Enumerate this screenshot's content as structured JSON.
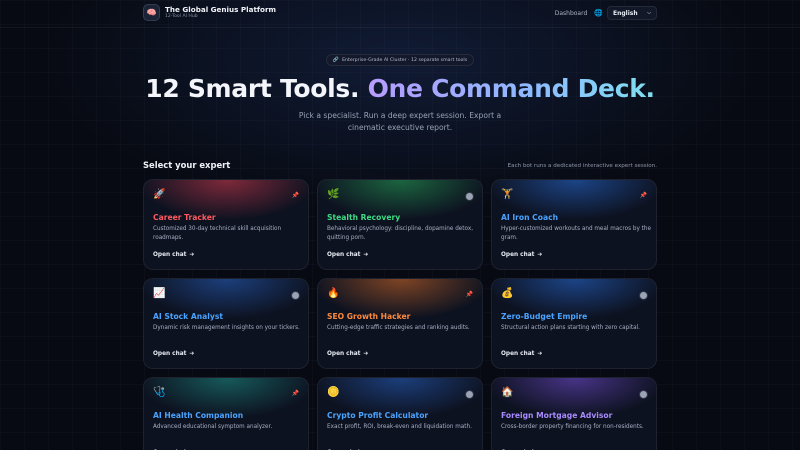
{
  "app": {
    "logo_icon": "🧠",
    "title": "The Global Genius Platform",
    "subtitle": "12-Tool AI Hub"
  },
  "nav": {
    "dashboard": "Dashboard",
    "globe_icon": "🌐",
    "language": "English",
    "chevron": "⌵"
  },
  "hero": {
    "badge_icon": "🔗",
    "badge": "Enterprise-Grade AI Cluster · 12 separate smart tools",
    "title_part1": "12 Smart Tools.",
    "title_part2": "One Command Deck.",
    "subtitle": "Pick a specialist. Run a deep expert session. Export a cinematic executive report."
  },
  "section": {
    "title": "Select your expert",
    "note": "Each bot runs a dedicated interactive expert session."
  },
  "cards": [
    {
      "icon": "🚀",
      "title": "Career Tracker",
      "desc": "Customized 30-day technical skill acquisition roadmaps.",
      "link": "Open chat",
      "arrow": "➔",
      "accent": "#ff5a5f",
      "glow": "rgba(220,60,80,0.55)",
      "status": "mini",
      "mini_icon": "📌"
    },
    {
      "icon": "🌿",
      "title": "Stealth Recovery",
      "desc": "Behavioral psychology: discipline, dopamine detox, quitting porn.",
      "link": "Open chat",
      "arrow": "➔",
      "accent": "#3ddc84",
      "glow": "rgba(40,170,90,0.55)",
      "status": "dot"
    },
    {
      "icon": "🏋️",
      "title": "AI Iron Coach",
      "desc": "Hyper-customized workouts and meal macros by the gram.",
      "link": "Open chat",
      "arrow": "➔",
      "accent": "#4aa3ff",
      "glow": "rgba(40,110,220,0.55)",
      "status": "mini",
      "mini_icon": "📌"
    },
    {
      "icon": "📈",
      "title": "AI Stock Analyst",
      "desc": "Dynamic risk management insights on your tickers.",
      "link": "Open chat",
      "arrow": "➔",
      "accent": "#4aa3ff",
      "glow": "rgba(40,100,200,0.55)",
      "status": "dot"
    },
    {
      "icon": "🔥",
      "title": "SEO Growth Hacker",
      "desc": "Cutting-edge traffic strategies and ranking audits.",
      "link": "Open chat",
      "arrow": "➔",
      "accent": "#ff8a3d",
      "glow": "rgba(220,110,40,0.55)",
      "status": "mini",
      "mini_icon": "📌"
    },
    {
      "icon": "💰",
      "title": "Zero-Budget Empire",
      "desc": "Structural action plans starting with zero capital.",
      "link": "Open chat",
      "arrow": "➔",
      "accent": "#4aa3ff",
      "glow": "rgba(40,110,220,0.55)",
      "status": "dot"
    },
    {
      "icon": "🩺",
      "title": "AI Health Companion",
      "desc": "Advanced educational symptom analyzer.",
      "link": "Open chat",
      "arrow": "➔",
      "accent": "#4aa3ff",
      "glow": "rgba(30,150,140,0.55)",
      "status": "mini",
      "mini_icon": "📌"
    },
    {
      "icon": "🪙",
      "title": "Crypto Profit Calculator",
      "desc": "Exact profit, ROI, break-even and liquidation math.",
      "link": "Open chat",
      "arrow": "➔",
      "accent": "#4aa3ff",
      "glow": "rgba(40,100,200,0.55)",
      "status": "dot"
    },
    {
      "icon": "🏠",
      "title": "Foreign Mortgage Advisor",
      "desc": "Cross-border property financing for non-residents.",
      "link": "Open chat",
      "arrow": "➔",
      "accent": "#a98bff",
      "glow": "rgba(120,80,220,0.55)",
      "status": "dot"
    }
  ]
}
